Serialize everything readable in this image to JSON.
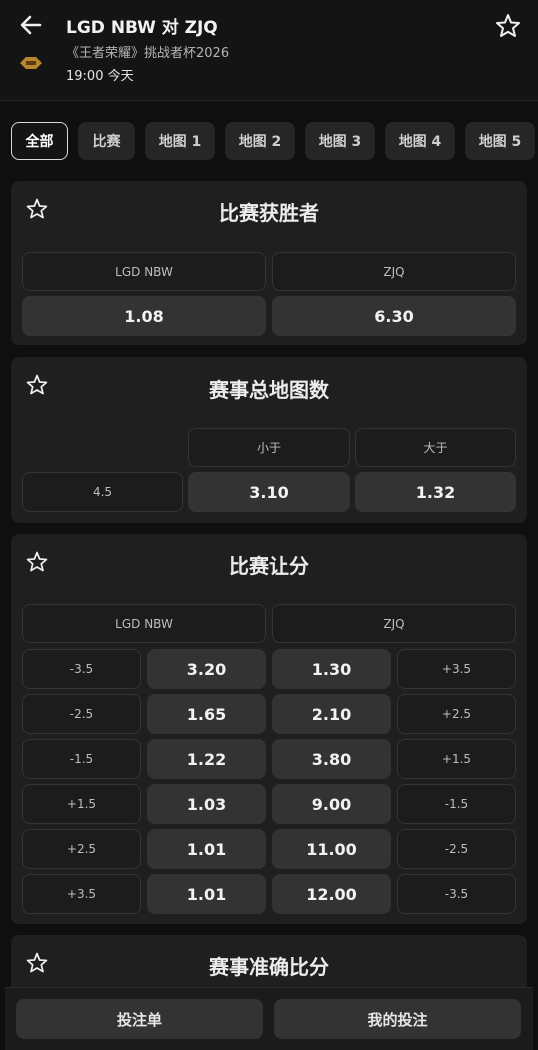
{
  "header": {
    "title": "LGD NBW  对  ZJQ",
    "subtitle": "《王者荣耀》挑战者杯2026",
    "time": "19:00 今天"
  },
  "tabs": [
    "全部",
    "比赛",
    "地图 1",
    "地图 2",
    "地图 3",
    "地图 4",
    "地图 5"
  ],
  "match_winner": {
    "title": "比赛获胜者",
    "teams": [
      "LGD NBW",
      "ZJQ"
    ],
    "odds": [
      "1.08",
      "6.30"
    ]
  },
  "total_maps": {
    "title": "赛事总地图数",
    "headers": [
      "小于",
      "大于"
    ],
    "line": "4.5",
    "odds": [
      "3.10",
      "1.32"
    ]
  },
  "handicap": {
    "title": "比赛让分",
    "teams": [
      "LGD NBW",
      "ZJQ"
    ],
    "rows": [
      {
        "h1": "-3.5",
        "o1": "3.20",
        "o2": "1.30",
        "h2": "+3.5"
      },
      {
        "h1": "-2.5",
        "o1": "1.65",
        "o2": "2.10",
        "h2": "+2.5"
      },
      {
        "h1": "-1.5",
        "o1": "1.22",
        "o2": "3.80",
        "h2": "+1.5"
      },
      {
        "h1": "+1.5",
        "o1": "1.03",
        "o2": "9.00",
        "h2": "-1.5"
      },
      {
        "h1": "+2.5",
        "o1": "1.01",
        "o2": "11.00",
        "h2": "-2.5"
      },
      {
        "h1": "+3.5",
        "o1": "1.01",
        "o2": "12.00",
        "h2": "-3.5"
      }
    ]
  },
  "correct_score": {
    "title": "赛事准确比分"
  },
  "bottom": {
    "betslip": "投注单",
    "my_bets": "我的投注"
  }
}
